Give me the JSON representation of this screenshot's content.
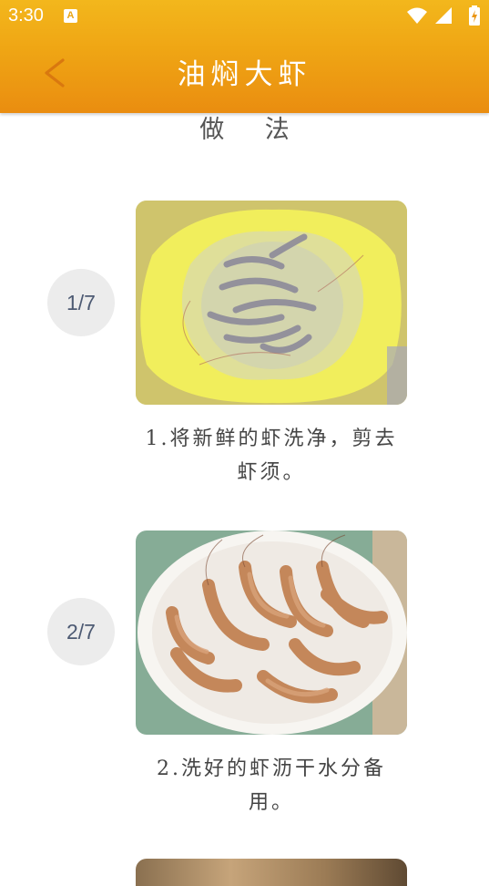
{
  "status_bar": {
    "time": "3:30",
    "notification_icon": "A",
    "icons": [
      "wifi-icon",
      "signal-icon",
      "battery-charging-icon"
    ]
  },
  "app_bar": {
    "back_icon": "chevron-left-icon",
    "title": "油焖大虾"
  },
  "section": {
    "title": "做 法"
  },
  "steps": [
    {
      "badge": "1/7",
      "image": "shrimp-in-yellow-colander",
      "text": "1.将新鲜的虾洗净，剪去虾须。"
    },
    {
      "badge": "2/7",
      "image": "shrimp-on-white-plate",
      "text": "2.洗好的虾沥干水分备用。"
    },
    {
      "image": "cooking-step-partial"
    }
  ],
  "colors": {
    "appbar_gradient_top": "#f3b71c",
    "appbar_gradient_bottom": "#ea8d10",
    "back_arrow": "#d9780f",
    "badge_bg": "#ececec",
    "badge_text": "#4d5a73",
    "body_text": "#444444"
  }
}
